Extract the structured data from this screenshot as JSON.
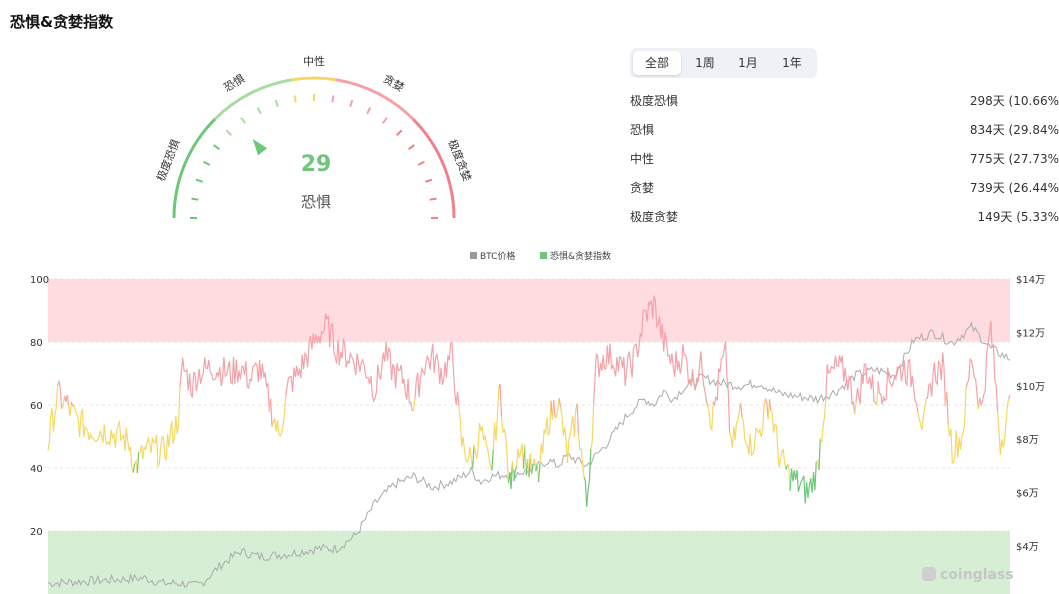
{
  "page": {
    "title": "恐惧&贪婪指数"
  },
  "gauge": {
    "value": 29,
    "value_text": "29",
    "state": "恐惧",
    "segment_labels": [
      "极度恐惧",
      "恐惧",
      "中性",
      "贪婪",
      "极度贪婪"
    ],
    "colors": {
      "green": "#6cc777",
      "light_green": "#a9dca5",
      "yellow": "#f5d863",
      "pink": "#f4a2a8",
      "red": "#ef8188"
    }
  },
  "tabs": {
    "items": [
      {
        "label": "全部",
        "active": true
      },
      {
        "label": "1周",
        "active": false
      },
      {
        "label": "1月",
        "active": false
      },
      {
        "label": "1年",
        "active": false
      }
    ]
  },
  "stats": [
    {
      "label": "极度恐惧",
      "value": "298天 (10.66%"
    },
    {
      "label": "恐惧",
      "value": "834天 (29.84%"
    },
    {
      "label": "中性",
      "value": "775天 (27.73%"
    },
    {
      "label": "贪婪",
      "value": "739天 (26.44%"
    },
    {
      "label": "极度贪婪",
      "value": "149天 (5.33%"
    }
  ],
  "watermark": "coinglass",
  "chart_data": {
    "type": "line",
    "legend": {
      "position": "top-center",
      "items": [
        {
          "name": "BTC价格",
          "color": "#999999"
        },
        {
          "name": "恐惧&贪婪指数",
          "color": "#6cc777"
        }
      ]
    },
    "y_left": {
      "ticks": [
        "100",
        "80",
        "60",
        "40",
        "20"
      ],
      "range": [
        0,
        100
      ]
    },
    "y_right": {
      "ticks": [
        "$14万",
        "$12万",
        "$10万",
        "$8万",
        "$6万",
        "$4万"
      ],
      "range_wan": [
        2.2,
        14
      ]
    },
    "bands": [
      {
        "from": 80,
        "to": 100,
        "color": "#fedcdf"
      },
      {
        "from": 0,
        "to": 20,
        "color": "#d6efd4"
      }
    ],
    "thresholds": {
      "fear": 40,
      "greed": 60
    },
    "line_colors": {
      "fear": "#6cc777",
      "neutral": "#f5d863",
      "greed": "#f4a2a8",
      "price": "#aaaaaa"
    },
    "series": [
      {
        "name": "恐惧&贪婪指数",
        "approx": true,
        "x": [
          0,
          0.01,
          0.02,
          0.03,
          0.045,
          0.06,
          0.075,
          0.085,
          0.09,
          0.1,
          0.11,
          0.12,
          0.135,
          0.14,
          0.15,
          0.155,
          0.17,
          0.19,
          0.2,
          0.21,
          0.22,
          0.24,
          0.25,
          0.26,
          0.27,
          0.28,
          0.29,
          0.3,
          0.31,
          0.33,
          0.34,
          0.35,
          0.36,
          0.37,
          0.38,
          0.39,
          0.4,
          0.41,
          0.42,
          0.43,
          0.44,
          0.45,
          0.46,
          0.47,
          0.48,
          0.49,
          0.5,
          0.51,
          0.52,
          0.53,
          0.54,
          0.55,
          0.56,
          0.57,
          0.58,
          0.59,
          0.6,
          0.61,
          0.62,
          0.63,
          0.64,
          0.65,
          0.66,
          0.67,
          0.68,
          0.69,
          0.7,
          0.705,
          0.71,
          0.72,
          0.73,
          0.74,
          0.75,
          0.76,
          0.77,
          0.78,
          0.79,
          0.8,
          0.81,
          0.82,
          0.83,
          0.84,
          0.85,
          0.86,
          0.87,
          0.88,
          0.89,
          0.9,
          0.91,
          0.92,
          0.93,
          0.94,
          0.95,
          0.96,
          0.97,
          0.98,
          0.99,
          1.0
        ],
        "values": [
          48,
          63,
          60,
          55,
          52,
          52,
          50,
          48,
          40,
          45,
          46,
          45,
          55,
          72,
          66,
          70,
          72,
          70,
          72,
          68,
          72,
          50,
          66,
          70,
          76,
          82,
          85,
          78,
          76,
          72,
          65,
          76,
          70,
          68,
          60,
          73,
          75,
          70,
          76,
          48,
          42,
          52,
          38,
          65,
          34,
          48,
          40,
          38,
          55,
          62,
          44,
          58,
          28,
          72,
          76,
          74,
          70,
          75,
          88,
          92,
          80,
          72,
          76,
          68,
          73,
          55,
          72,
          76,
          45,
          58,
          47,
          52,
          62,
          44,
          38,
          35,
          32,
          40,
          68,
          72,
          70,
          60,
          72,
          63,
          66,
          70,
          72,
          68,
          52,
          70,
          72,
          46,
          50,
          76,
          58,
          85,
          48,
          60
        ]
      },
      {
        "name": "BTC价格",
        "approx": true,
        "unit": "万美元",
        "x": [
          0,
          0.05,
          0.1,
          0.12,
          0.14,
          0.15,
          0.16,
          0.18,
          0.2,
          0.22,
          0.25,
          0.28,
          0.3,
          0.32,
          0.34,
          0.36,
          0.38,
          0.4,
          0.42,
          0.44,
          0.45,
          0.46,
          0.48,
          0.5,
          0.52,
          0.53,
          0.54,
          0.56,
          0.58,
          0.6,
          0.61,
          0.62,
          0.63,
          0.64,
          0.65,
          0.66,
          0.68,
          0.7,
          0.72,
          0.74,
          0.76,
          0.78,
          0.8,
          0.82,
          0.84,
          0.86,
          0.88,
          0.9,
          0.92,
          0.94,
          0.96,
          0.98,
          1.0
        ],
        "values": [
          2.6,
          2.7,
          2.8,
          2.6,
          2.6,
          2.5,
          2.6,
          3.3,
          3.8,
          3.6,
          3.7,
          3.9,
          3.9,
          4.4,
          5.6,
          6.3,
          6.6,
          6.2,
          6.4,
          6.8,
          6.4,
          6.6,
          6.7,
          6.8,
          7.2,
          7.0,
          7.4,
          7.0,
          7.8,
          8.8,
          9.2,
          9.5,
          9.3,
          9.8,
          9.5,
          9.9,
          10.3,
          10.1,
          10.0,
          10.1,
          9.7,
          9.6,
          9.5,
          9.8,
          10.4,
          10.6,
          10.4,
          11.7,
          12.0,
          11.6,
          12.2,
          11.4,
          11.0
        ]
      }
    ]
  }
}
